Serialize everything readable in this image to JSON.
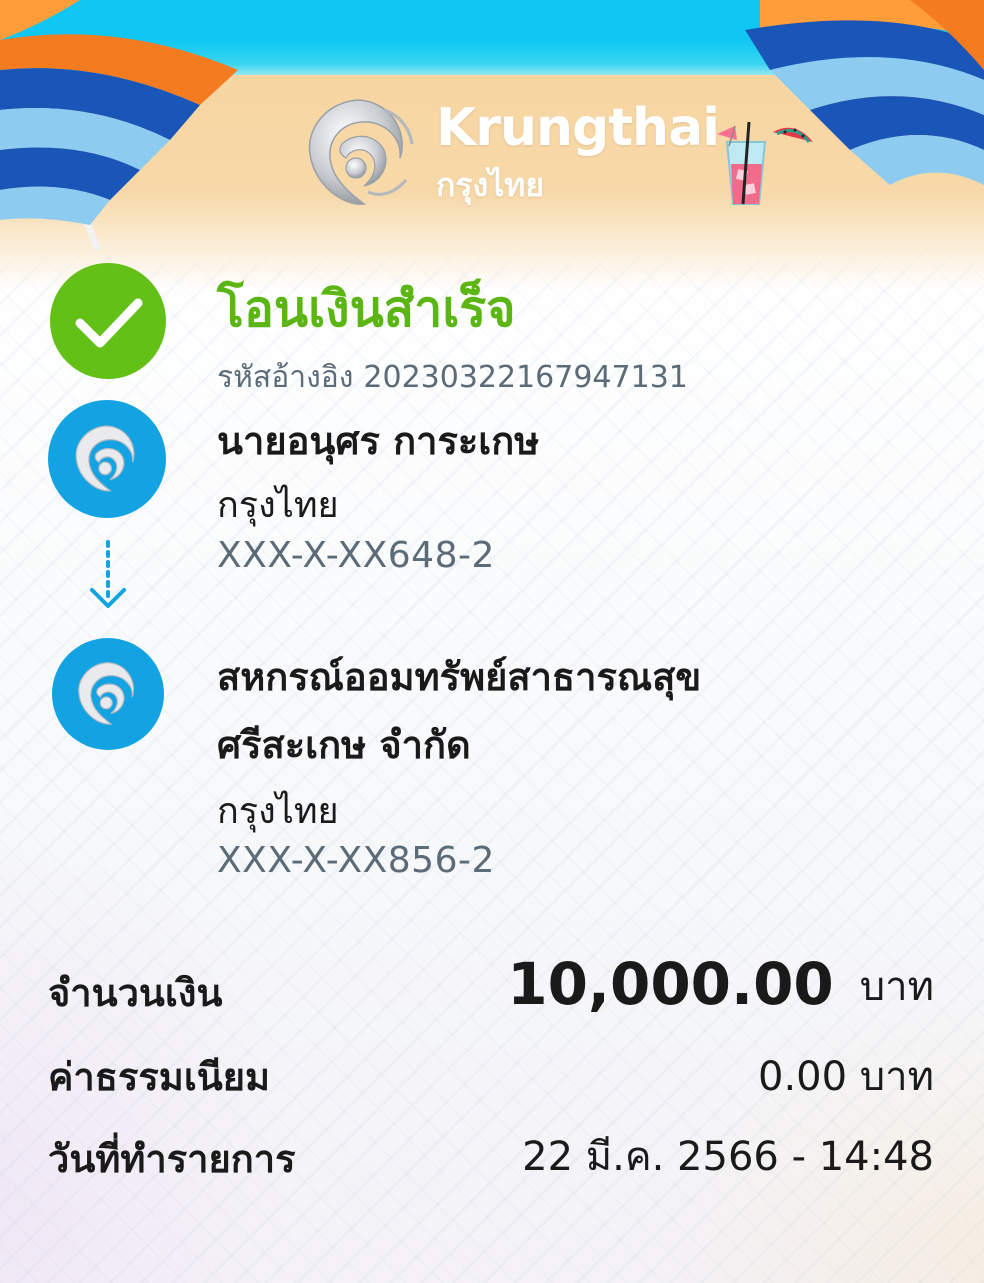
{
  "header": {
    "brand_en": "Krungthai",
    "brand_th": "กรุงไทย",
    "colors": {
      "sky": "#10c7f4",
      "sand": "#f7d6a2",
      "brand_blue": "#13a3e2"
    }
  },
  "status": {
    "title": "โอนเงินสำเร็จ",
    "icon": "check-icon",
    "color": "#5bb512",
    "ref_label": "รหัสอ้างอิง",
    "ref_value": "20230322167947131"
  },
  "sender": {
    "name": "นายอนุศร การะเกษ",
    "bank": "กรุงไทย",
    "account": "XXX-X-XX648-2"
  },
  "receiver": {
    "name_line1": "สหกรณ์ออมทรัพย์สาธารณสุข",
    "name_line2": "ศรีสะเกษ จำกัด",
    "bank": "กรุงไทย",
    "account": "XXX-X-XX856-2"
  },
  "summary": {
    "amount_label": "จำนวนเงิน",
    "amount_value": "10,000.00",
    "amount_unit": "บาท",
    "fee_label": "ค่าธรรมเนียม",
    "fee_value": "0.00 บาท",
    "date_label": "วันที่ทำรายการ",
    "date_value": "22 มี.ค. 2566 - 14:48"
  }
}
